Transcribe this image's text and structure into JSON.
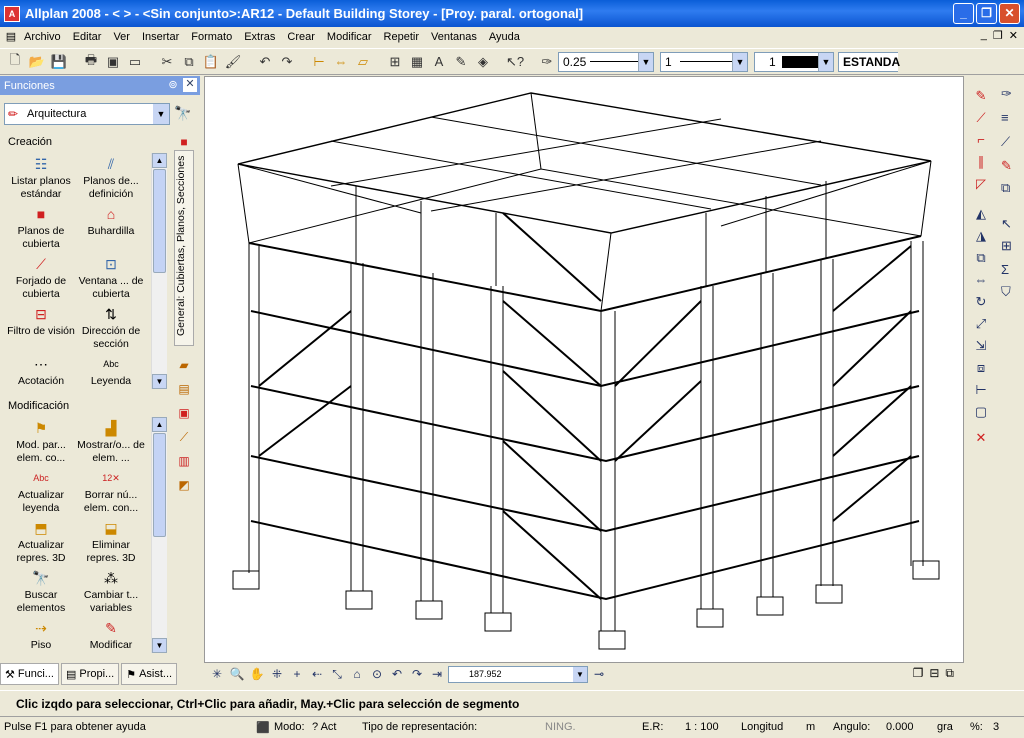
{
  "window": {
    "title": "Allplan 2008 - <       > - <Sin conjunto>:AR12 - Default Building Storey - [Proy. paral. ortogonal]"
  },
  "menu": [
    "Archivo",
    "Editar",
    "Ver",
    "Insertar",
    "Formato",
    "Extras",
    "Crear",
    "Modificar",
    "Repetir",
    "Ventanas",
    "Ayuda"
  ],
  "toolbar": {
    "pen_thickness": "0.25",
    "line_type": "1",
    "color": "1",
    "layer": "ESTANDA"
  },
  "functions": {
    "header": "Funciones",
    "module": "Arquitectura",
    "creation_label": "Creación",
    "creation": [
      {
        "label": "Listar planos estándar",
        "icon": "list-planes-icon"
      },
      {
        "label": "Planos de... definición",
        "icon": "planes-definition-icon"
      },
      {
        "label": "Planos de cubierta",
        "icon": "roof-planes-icon"
      },
      {
        "label": "Buhardilla",
        "icon": "dormer-icon"
      },
      {
        "label": "Forjado de cubierta",
        "icon": "roof-slab-icon"
      },
      {
        "label": "Ventana ... de cubierta",
        "icon": "roof-window-icon"
      },
      {
        "label": "Filtro de visión",
        "icon": "view-filter-icon"
      },
      {
        "label": "Dirección de sección",
        "icon": "section-direction-icon"
      },
      {
        "label": "Acotación",
        "icon": "dimension-icon"
      },
      {
        "label": "Leyenda",
        "icon": "legend-icon"
      }
    ],
    "modification_label": "Modificación",
    "modification": [
      {
        "label": "Mod. par... elem. co...",
        "icon": "modify-params-icon"
      },
      {
        "label": "Mostrar/o... de elem. ...",
        "icon": "show-hide-icon"
      },
      {
        "label": "Actualizar leyenda",
        "icon": "update-legend-icon"
      },
      {
        "label": "Borrar nú... elem. con...",
        "icon": "delete-numbers-icon"
      },
      {
        "label": "Actualizar repres. 3D",
        "icon": "update-3d-icon"
      },
      {
        "label": "Eliminar repres. 3D",
        "icon": "remove-3d-icon"
      },
      {
        "label": "Buscar elementos",
        "icon": "find-elements-icon"
      },
      {
        "label": "Cambiar t... variables",
        "icon": "change-variables-icon"
      },
      {
        "label": "Piso",
        "icon": "floor-icon"
      },
      {
        "label": "Modificar",
        "icon": "modify-icon"
      }
    ],
    "vertical_tab": "General: Cubiertas, Planos, Secciones"
  },
  "bottom_tabs": [
    "Funci...",
    "Propi...",
    "Asist..."
  ],
  "nav": {
    "zoom_value": "187.952"
  },
  "prompt": "Clic izqdo para seleccionar, Ctrl+Clic para añadir, May.+Clic para selección de segmento",
  "status": {
    "help": "Pulse F1 para obtener ayuda",
    "mode_label": "Modo:",
    "mode_value": "? Act",
    "repr_label": "Tipo de representación:",
    "repr_value": "NING.",
    "scale_label": "E.R:",
    "scale_value": "1 : 100",
    "length_label": "Longitud",
    "length_unit": "m",
    "angle_label": "Angulo:",
    "angle_value": "0.000",
    "angle_unit": "gra",
    "percent_label": "%:",
    "percent_value": "3"
  },
  "colors": {
    "titlebar": "#0a5ed8",
    "panel_header": "#7a9ee0",
    "accent_red": "#d02020"
  }
}
